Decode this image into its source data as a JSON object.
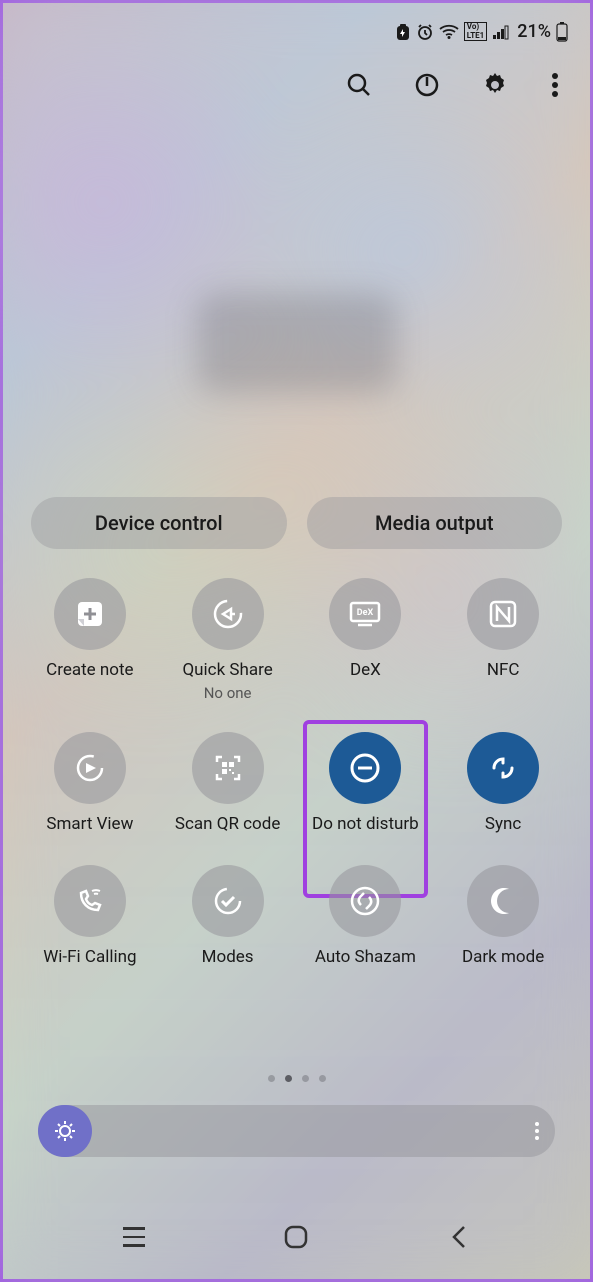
{
  "status": {
    "battery_pct": "21%"
  },
  "panel": {
    "device_control": "Device control",
    "media_output": "Media output"
  },
  "tiles": {
    "create_note": "Create note",
    "quick_share": "Quick Share",
    "quick_share_sub": "No one",
    "dex": "DeX",
    "nfc": "NFC",
    "smart_view": "Smart View",
    "scan_qr": "Scan QR code",
    "dnd": "Do not disturb",
    "sync": "Sync",
    "wifi_calling": "Wi-Fi Calling",
    "modes": "Modes",
    "auto_shazam": "Auto Shazam",
    "dark_mode": "Dark mode"
  }
}
